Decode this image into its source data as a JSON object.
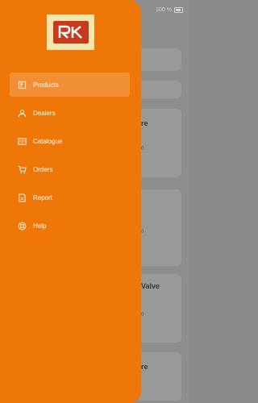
{
  "status": {
    "battery_text": "100 %"
  },
  "background": {
    "title1": "re",
    "title2": "Valve",
    "title3": "re",
    "small1": "0",
    "small2": "0",
    "small3": "0"
  },
  "drawer": {
    "bg_color": "#ee7707",
    "active_color": "#f08f34",
    "logo_alt": "RK",
    "items": [
      {
        "label": "Products",
        "icon": "box-icon",
        "active": true
      },
      {
        "label": "Dealers",
        "icon": "user-icon",
        "active": false
      },
      {
        "label": "Catalogue",
        "icon": "catalogue-icon",
        "active": false
      },
      {
        "label": "Orders",
        "icon": "cart-icon",
        "active": false
      },
      {
        "label": "Report",
        "icon": "report-icon",
        "active": false
      },
      {
        "label": "Help",
        "icon": "help-icon",
        "active": false
      }
    ]
  }
}
